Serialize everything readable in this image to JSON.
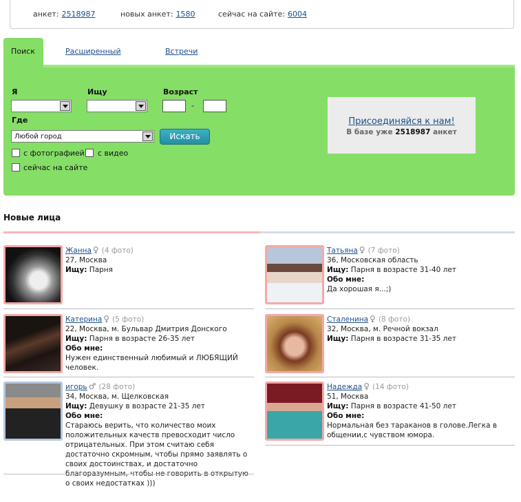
{
  "stats": {
    "profiles_label": "анкет:",
    "profiles_value": "2518987",
    "new_label": "новых анкет:",
    "new_value": "1580",
    "online_label": "сейчас на сайте:",
    "online_value": "6004"
  },
  "tabs": {
    "search": "Поиск",
    "advanced": "Расширенный",
    "meetings": "Встречи"
  },
  "form": {
    "i_label": "Я",
    "seek_label": "Ищу",
    "age_label": "Возраст",
    "age_dash": "-",
    "where_label": "Где",
    "city_value": "Любой город",
    "search_button": "Искать",
    "with_photo": "с фотографией",
    "with_video": "с видео",
    "online_now": "сейчас на сайте"
  },
  "join": {
    "link": "Присоединяйся к нам!",
    "text_before": "В базе уже",
    "count": "2518987",
    "text_after": "анкет"
  },
  "new_faces": {
    "title": "Новые лица",
    "seek_label": "Ищу:",
    "about_label": "Обо мне:",
    "left": [
      {
        "name": "Жанна",
        "sym": "♀",
        "photos": "(4 фото)",
        "details": "27, Москва",
        "seek": "Парня",
        "about": ""
      },
      {
        "name": "Катерина",
        "sym": "♀",
        "photos": "(5 фото)",
        "details": "22, Москва, м. Бульвар Дмитрия Донского",
        "seek": "Парня в возрасте 26-35 лет",
        "about": "Нужен единственный любимый и ЛЮБЯЩИЙ человек."
      },
      {
        "name": "игорь",
        "sym": "♂",
        "photos": "(28 фото)",
        "details": "34, Москва, м. Щелковская",
        "seek": "Девушку в возрасте 21-35 лет",
        "about": "Стараюсь верить, что количество моих положительных качеств превосходит число отрицательных. При этом считаю себя достаточно скромным, чтобы прямо заявлять о своих достоинствах, и достаточно благоразумным, чтобы не говорить в открытую о своих недостатках )))"
      }
    ],
    "right": [
      {
        "name": "Татьяна",
        "sym": "♀",
        "photos": "(7 фото)",
        "details": "36, Московская область",
        "seek": "Парня в возрасте 31-40 лет",
        "about": "Да хорошая я...;)"
      },
      {
        "name": "Сталенина",
        "sym": "♀",
        "photos": "(8 фото)",
        "details": "32, Москва, м. Речной вокзал",
        "seek": "Парня в возрасте 31-35 лет",
        "about": ""
      },
      {
        "name": "Надежда",
        "sym": "♀",
        "photos": "(14 фото)",
        "details": "51, Москва",
        "seek": "Парня в возрасте 41-50 лет",
        "about": "Нормальная без тараканов в голове.Легка в общении,с чувством юмора."
      }
    ]
  }
}
